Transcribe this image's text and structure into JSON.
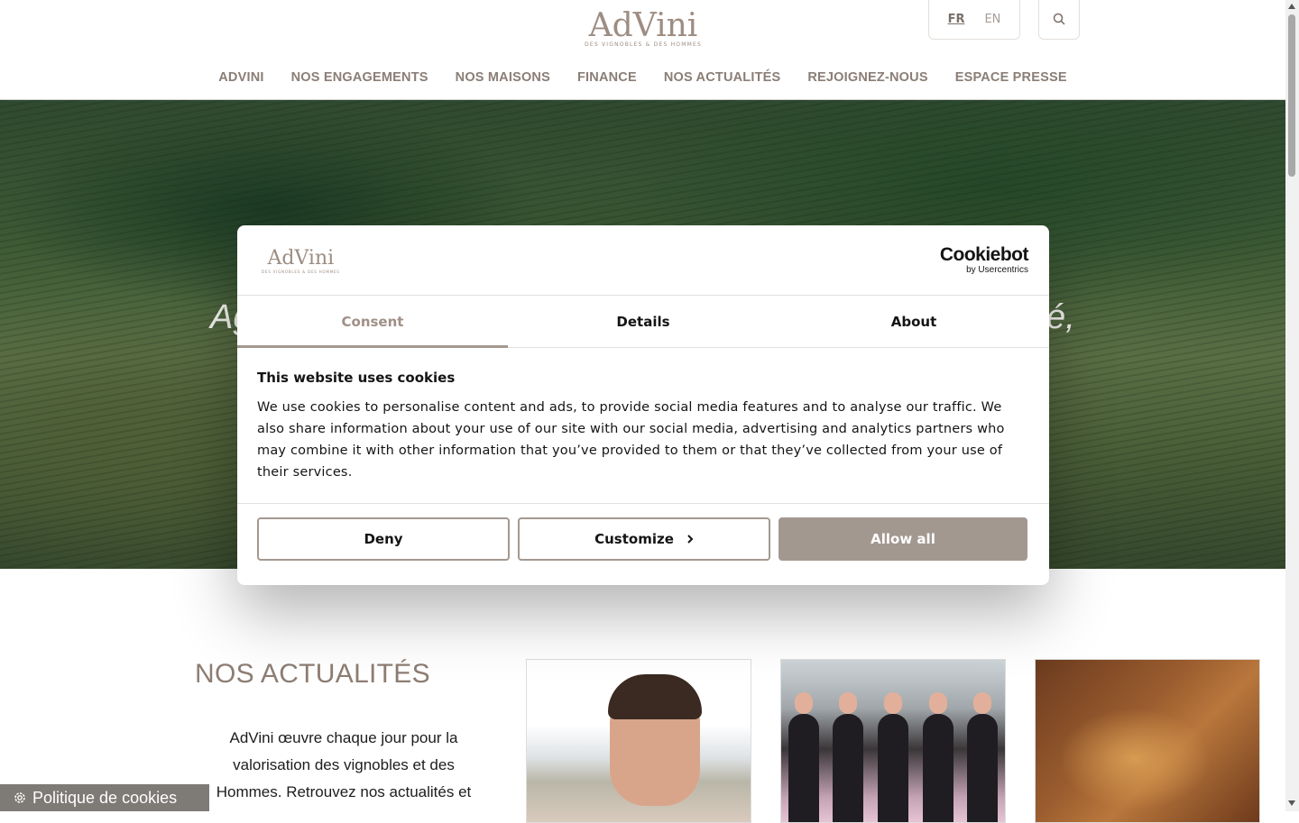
{
  "header": {
    "logo": {
      "word": "AdVini",
      "tagline": "DES VIGNOBLES & DES HOMMES"
    },
    "languages": [
      {
        "label": "FR",
        "active": true
      },
      {
        "label": "EN",
        "active": false
      }
    ],
    "search_icon": "search-icon",
    "nav": [
      "ADVINI",
      "NOS ENGAGEMENTS",
      "NOS MAISONS",
      "FINANCE",
      "NOS ACTUALITÉS",
      "REJOIGNEZ-NOUS",
      "ESPACE PRESSE"
    ]
  },
  "hero": {
    "text_left": "Ag",
    "text_right": "é,"
  },
  "cookie_dialog": {
    "logo": {
      "word": "AdVini",
      "tagline": "DES VIGNOBLES & DES HOMMES"
    },
    "provider": {
      "name": "Cookiebot",
      "sub": "by Usercentrics"
    },
    "tabs": [
      {
        "label": "Consent",
        "active": true
      },
      {
        "label": "Details",
        "active": false
      },
      {
        "label": "About",
        "active": false
      }
    ],
    "title": "This website uses cookies",
    "text": "We use cookies to personalise content and ads, to provide social media features and to analyse our traffic. We also share information about your use of our site with our social media, advertising and analytics partners who may combine it with other information that you’ve provided to them or that they’ve collected from your use of their services.",
    "buttons": {
      "deny": "Deny",
      "customize": "Customize",
      "allow": "Allow all"
    },
    "colors": {
      "accent": "#a39890"
    }
  },
  "news": {
    "title": "NOS ACTUALITÉS",
    "text": "AdVini œuvre chaque jour pour la valorisation des vignobles et des Hommes. Retrouvez nos actualités et"
  },
  "cookie_policy": {
    "label": "Politique de cookies",
    "icon": "gear-icon"
  }
}
